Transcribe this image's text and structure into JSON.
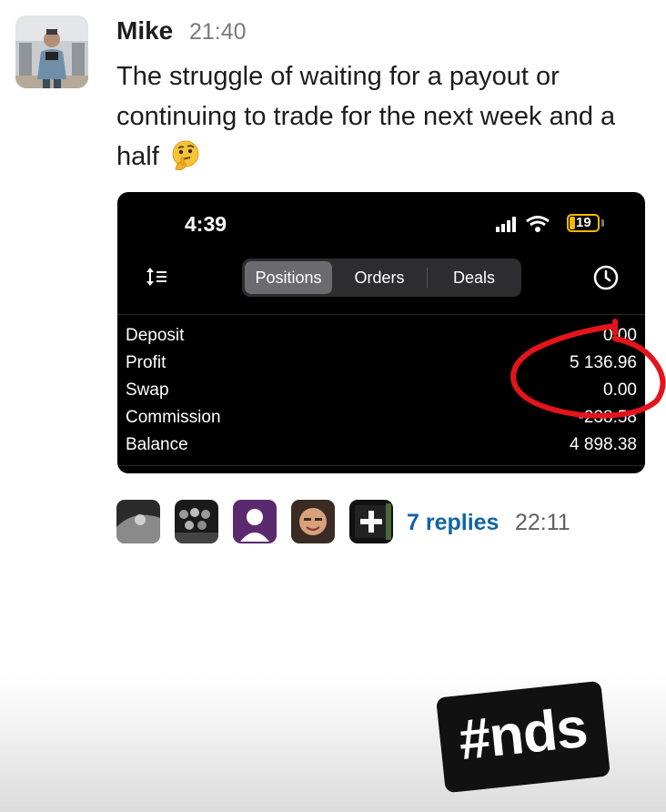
{
  "message": {
    "author": "Mike",
    "time": "21:40",
    "text": "The struggle of waiting for a payout or continuing to trade for the next week and a half",
    "emoji": "thinking-face"
  },
  "screenshot": {
    "status_time": "4:39",
    "battery": "19",
    "tabs": [
      "Positions",
      "Orders",
      "Deals"
    ],
    "active_tab": "Positions",
    "rows": [
      {
        "label": "Deposit",
        "value": "0.00"
      },
      {
        "label": "Profit",
        "value": "5 136.96"
      },
      {
        "label": "Swap",
        "value": "0.00"
      },
      {
        "label": "Commission",
        "value": "-238.58"
      },
      {
        "label": "Balance",
        "value": "4 898.38"
      }
    ],
    "annotation_color": "#e3141b"
  },
  "thread": {
    "replies": "7 replies",
    "time": "22:11"
  },
  "tag": "#nds",
  "colors": {
    "link": "#1264a3",
    "text": "#1d1c1d",
    "muted": "#7a7a7a",
    "battery": "#f6b800"
  }
}
